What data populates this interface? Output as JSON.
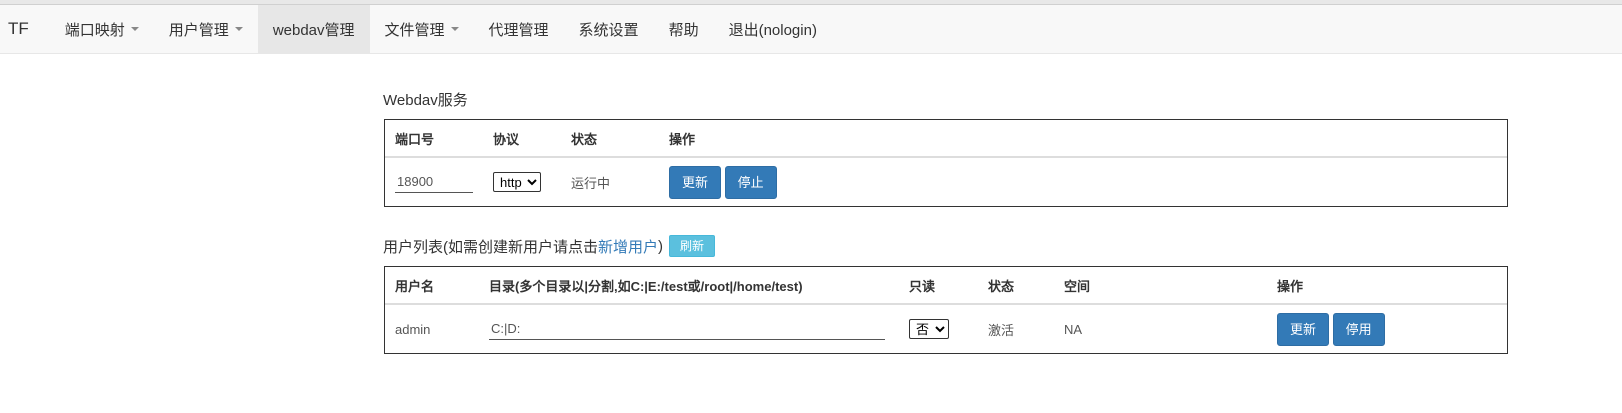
{
  "navbar": {
    "brand": "TF",
    "items": [
      {
        "label": "端口映射",
        "dropdown": true
      },
      {
        "label": "用户管理",
        "dropdown": true
      },
      {
        "label": "webdav管理",
        "dropdown": false,
        "active": true
      },
      {
        "label": "文件管理",
        "dropdown": true
      },
      {
        "label": "代理管理",
        "dropdown": false
      },
      {
        "label": "系统设置",
        "dropdown": false
      },
      {
        "label": "帮助",
        "dropdown": false
      },
      {
        "label": "退出(nologin)",
        "dropdown": false
      }
    ]
  },
  "webdav": {
    "title": "Webdav服务",
    "columns": [
      "端口号",
      "协议",
      "状态",
      "操作"
    ],
    "port": "18900",
    "protocol": "http",
    "status": "运行中",
    "update_label": "更新",
    "stop_label": "停止"
  },
  "users": {
    "title_prefix": "用户列表(如需创建新用户请点击",
    "add_link": "新增用户",
    "title_suffix": ")",
    "refresh_label": "刷新",
    "columns": [
      "用户名",
      "目录(多个目录以|分割,如C:|E:/test或/root|/home/test)",
      "只读",
      "状态",
      "空间",
      "操作"
    ],
    "row": {
      "username": "admin",
      "directory": "C:|D:",
      "readonly": "否",
      "status": "激活",
      "space": "NA",
      "update_label": "更新",
      "disable_label": "停用"
    }
  }
}
